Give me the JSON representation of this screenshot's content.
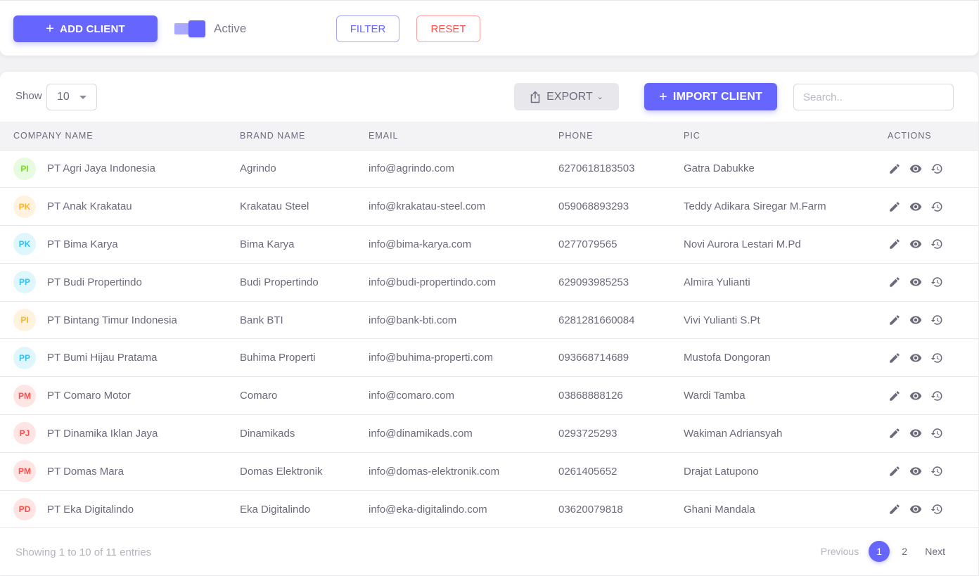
{
  "toolbar": {
    "add_client_label": "ADD CLIENT",
    "add_client_icon": "plus-icon",
    "toggle_label": "Active",
    "toggle_on": true,
    "filter_label": "FILTER",
    "reset_label": "RESET"
  },
  "table_controls": {
    "show_label": "Show",
    "page_size": "10",
    "export_label": "EXPORT",
    "export_icon": "share-icon",
    "import_label": "IMPORT CLIENT",
    "search_placeholder": "Search..",
    "search_value": ""
  },
  "colors": {
    "primary": "#6666ff",
    "danger": "#ff4d49",
    "avatar_green_bg": "#e8fadf",
    "avatar_green_fg": "#72e128",
    "avatar_orange_bg": "#fff3e0",
    "avatar_orange_fg": "#fdb528",
    "avatar_blue_bg": "#dff6fd",
    "avatar_blue_fg": "#26c6f9",
    "avatar_red_bg": "#ffe4e4",
    "avatar_red_fg": "#ff4d49"
  },
  "columns": [
    "COMPANY NAME",
    "BRAND NAME",
    "EMAIL",
    "PHONE",
    "PIC",
    "ACTIONS"
  ],
  "rows": [
    {
      "initials": "PI",
      "color": "green",
      "company": "PT Agri Jaya Indonesia",
      "brand": "Agrindo",
      "email": "info@agrindo.com",
      "phone": "6270618183503",
      "pic": "Gatra Dabukke"
    },
    {
      "initials": "PK",
      "color": "orange",
      "company": "PT Anak Krakatau",
      "brand": "Krakatau Steel",
      "email": "info@krakatau-steel.com",
      "phone": "059068893293",
      "pic": "Teddy Adikara Siregar M.Farm"
    },
    {
      "initials": "PK",
      "color": "blue",
      "company": "PT Bima Karya",
      "brand": "Bima Karya",
      "email": "info@bima-karya.com",
      "phone": "0277079565",
      "pic": "Novi Aurora Lestari M.Pd"
    },
    {
      "initials": "PP",
      "color": "blue",
      "company": "PT Budi Propertindo",
      "brand": "Budi Propertindo",
      "email": "info@budi-propertindo.com",
      "phone": "629093985253",
      "pic": "Almira Yulianti"
    },
    {
      "initials": "PI",
      "color": "orange",
      "company": "PT Bintang Timur Indonesia",
      "brand": "Bank BTI",
      "email": "info@bank-bti.com",
      "phone": "6281281660084",
      "pic": "Vivi Yulianti S.Pt"
    },
    {
      "initials": "PP",
      "color": "blue",
      "company": "PT Bumi Hijau Pratama",
      "brand": "Buhima Properti",
      "email": "info@buhima-properti.com",
      "phone": "093668714689",
      "pic": "Mustofa Dongoran"
    },
    {
      "initials": "PM",
      "color": "red",
      "company": "PT Comaro Motor",
      "brand": "Comaro",
      "email": "info@comaro.com",
      "phone": "03868888126",
      "pic": "Wardi Tamba"
    },
    {
      "initials": "PJ",
      "color": "red",
      "company": "PT Dinamika Iklan Jaya",
      "brand": "Dinamikads",
      "email": "info@dinamikads.com",
      "phone": "0293725293",
      "pic": "Wakiman Adriansyah"
    },
    {
      "initials": "PM",
      "color": "red",
      "company": "PT Domas Mara",
      "brand": "Domas Elektronik",
      "email": "info@domas-elektronik.com",
      "phone": "0261405652",
      "pic": "Drajat Latupono"
    },
    {
      "initials": "PD",
      "color": "red",
      "company": "PT Eka Digitalindo",
      "brand": "Eka Digitalindo",
      "email": "info@eka-digitalindo.com",
      "phone": "03620079818",
      "pic": "Ghani Mandala"
    }
  ],
  "row_actions": [
    "edit-icon",
    "view-icon",
    "history-icon"
  ],
  "footer": {
    "entries_text": "Showing 1 to 10 of 11 entries",
    "previous_label": "Previous",
    "pages": [
      "1",
      "2"
    ],
    "current_page": "1",
    "next_label": "Next"
  }
}
